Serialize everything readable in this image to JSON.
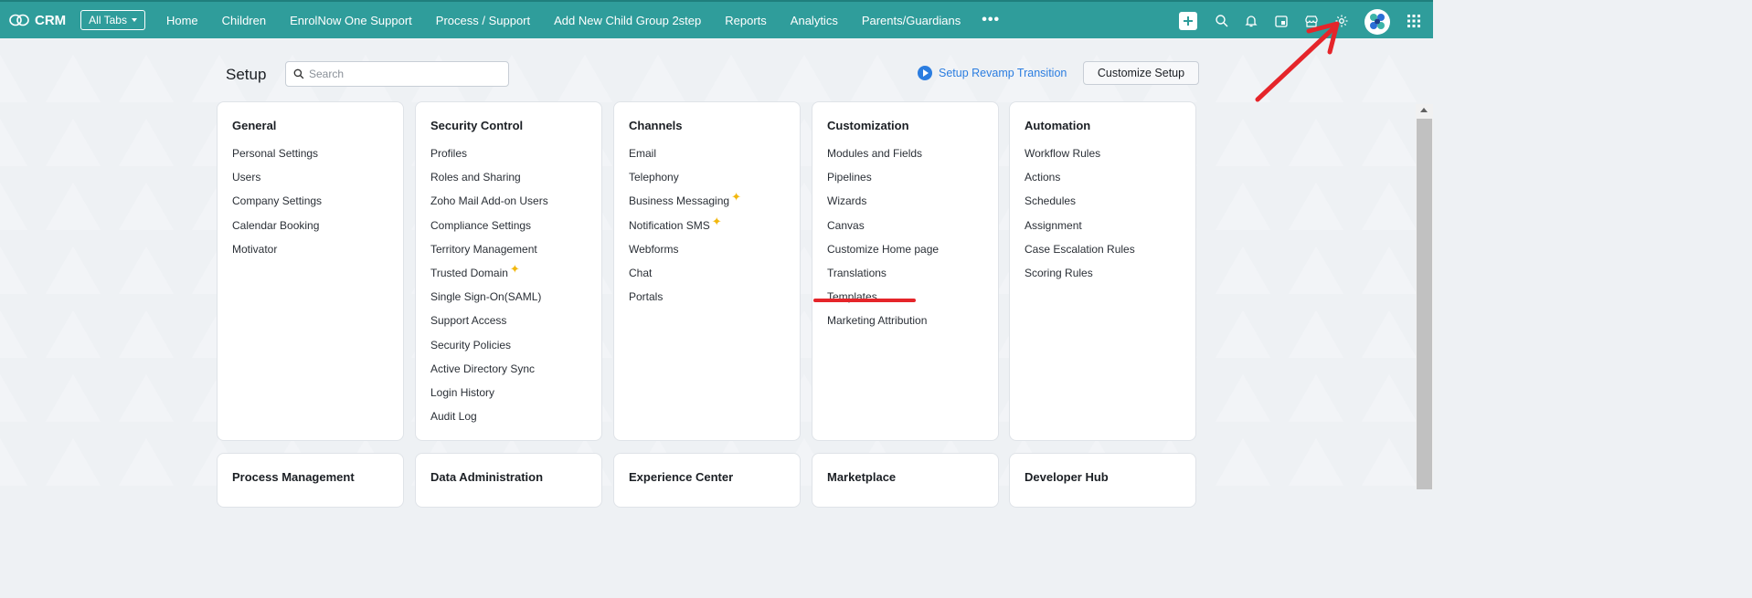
{
  "topbar": {
    "app_name": "CRM",
    "all_tabs_label": "All Tabs",
    "tabs": [
      "Home",
      "Children",
      "EnrolNow One Support",
      "Process / Support",
      "Add New Child Group 2step",
      "Reports",
      "Analytics",
      "Parents/Guardians"
    ],
    "more_label": "•••",
    "icons": [
      "plus-icon",
      "search-icon",
      "bell-icon",
      "calendar-icon",
      "marketplace-icon",
      "gear-icon",
      "avatar",
      "apps-grid-icon"
    ],
    "color": "#2f9d9b"
  },
  "setup": {
    "title": "Setup",
    "search_placeholder": "Search",
    "revamp_label": "Setup Revamp Transition",
    "customize_label": "Customize Setup"
  },
  "cards": [
    {
      "title": "General",
      "items": [
        "Personal Settings",
        "Users",
        "Company Settings",
        "Calendar Booking",
        "Motivator"
      ]
    },
    {
      "title": "Security Control",
      "items": [
        "Profiles",
        "Roles and Sharing",
        "Zoho Mail Add-on Users",
        "Compliance Settings",
        "Territory Management",
        "Trusted Domain",
        "Single Sign-On(SAML)",
        "Support Access",
        "Security Policies",
        "Active Directory Sync",
        "Login History",
        "Audit Log"
      ]
    },
    {
      "title": "Channels",
      "items": [
        "Email",
        "Telephony",
        "Business Messaging",
        "Notification SMS",
        "Webforms",
        "Chat",
        "Portals"
      ]
    },
    {
      "title": "Customization",
      "items": [
        "Modules and Fields",
        "Pipelines",
        "Wizards",
        "Canvas",
        "Customize Home page",
        "Translations",
        "Templates",
        "Marketing Attribution"
      ]
    },
    {
      "title": "Automation",
      "items": [
        "Workflow Rules",
        "Actions",
        "Schedules",
        "Assignment",
        "Case Escalation Rules",
        "Scoring Rules"
      ]
    }
  ],
  "bottom_cards": [
    {
      "title": "Process Management"
    },
    {
      "title": "Data Administration"
    },
    {
      "title": "Experience Center"
    },
    {
      "title": "Marketplace"
    },
    {
      "title": "Developer Hub"
    }
  ],
  "annotations": {
    "color": "#e5252a"
  }
}
